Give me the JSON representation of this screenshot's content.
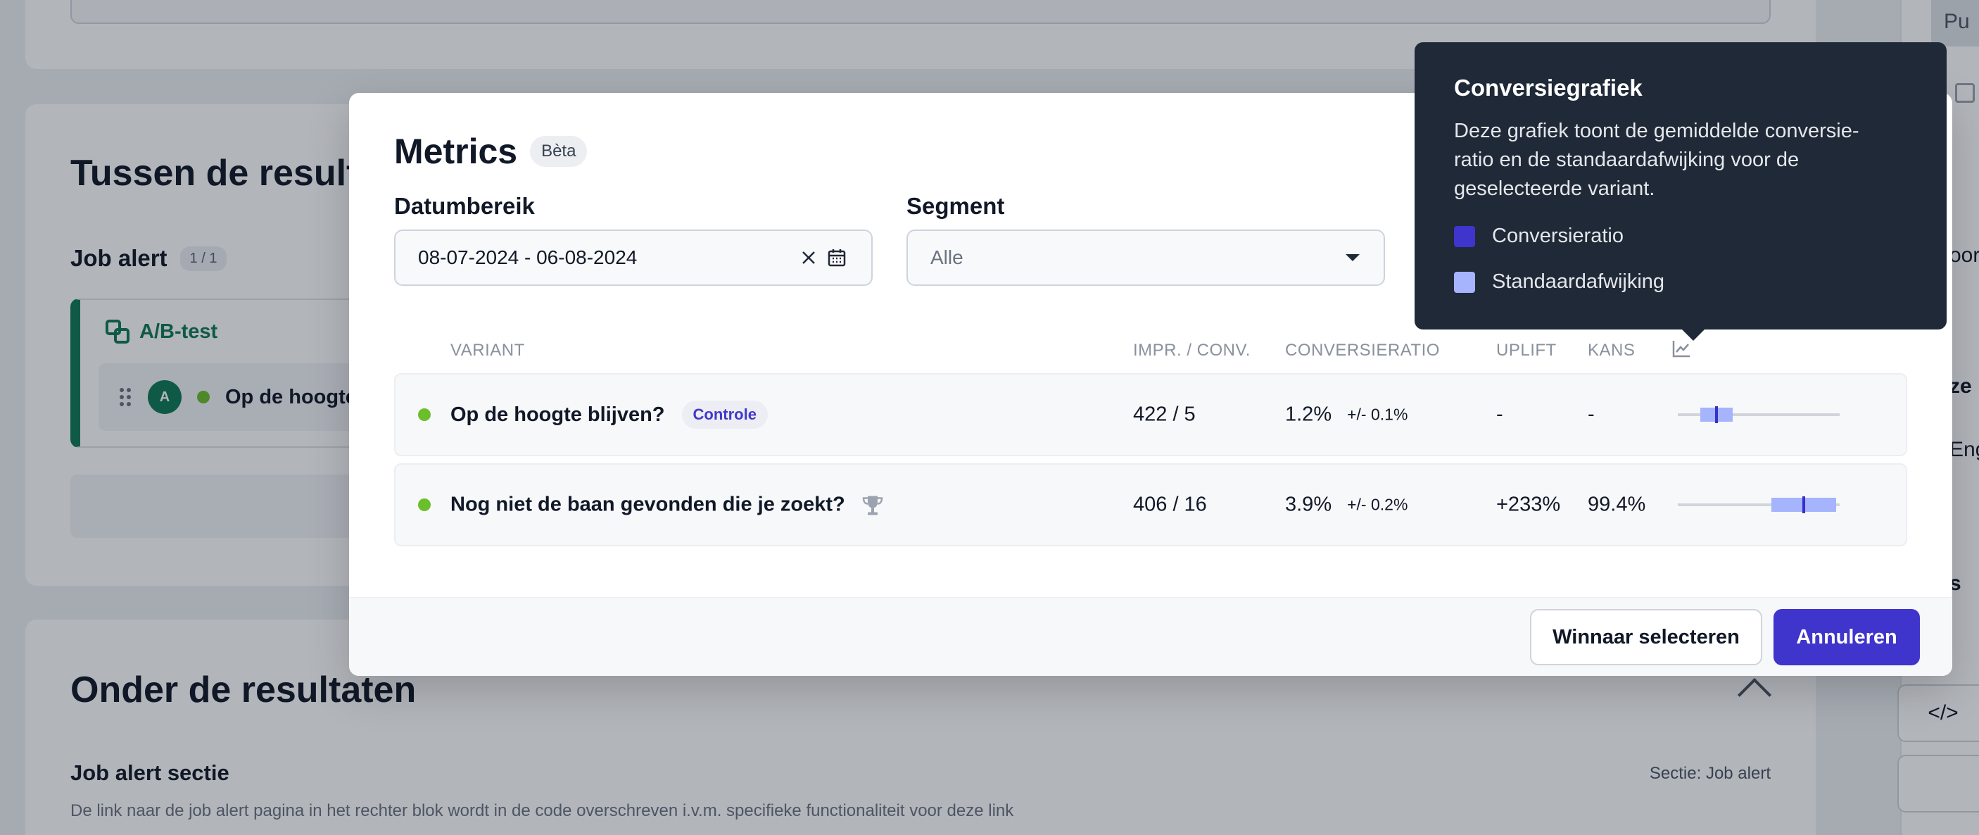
{
  "background": {
    "section1_title": "Tussen de resultaten",
    "job_alert_label": "Job alert",
    "job_alert_count": "1 / 1",
    "ab_title": "A/B-test",
    "ab_row_avatar": "A",
    "ab_row_text": "Op de hoogte blijven?",
    "section2_title": "Onder de resultaten",
    "sub_title": "Job alert sectie",
    "sub_right": "Sectie: Job alert",
    "sub_desc": "De link naar de job alert pagina in het rechter blok wordt in de code overschreven i.v.m. specifieke functionaliteit voor deze link",
    "publish_label": "Pu",
    "side_text_1": "oor",
    "side_text_2": "ze",
    "side_text_3": "Eng",
    "side_text_4": "s",
    "code_btn_label": "</>"
  },
  "modal": {
    "title": "Metrics",
    "beta_badge": "Bèta",
    "date_label": "Datumbereik",
    "date_value": "08-07-2024 - 06-08-2024",
    "segment_label": "Segment",
    "segment_value": "Alle",
    "columns": {
      "variant": "VARIANT",
      "impr_conv": "IMPR. / CONV.",
      "conversion": "CONVERSIERATIO",
      "uplift": "UPLIFT",
      "chance": "KANS"
    },
    "rows": [
      {
        "name": "Op de hoogte blijven?",
        "badge": "Controle",
        "impr_conv": "422 / 5",
        "rate": "1.2%",
        "pm": "+/- 0.1%",
        "uplift": "-",
        "chance": "-",
        "rate_value": 1.2,
        "sd_value": 0.1
      },
      {
        "name": "Nog niet de baan gevonden die je zoekt?",
        "impr_conv": "406 / 16",
        "rate": "3.9%",
        "pm": "+/- 0.2%",
        "uplift": "+233%",
        "chance": "99.4%",
        "rate_value": 3.9,
        "sd_value": 0.2,
        "winner": true
      }
    ],
    "chart_scale_max": 5.0,
    "btn_select_winner": "Winnaar selecteren",
    "btn_cancel": "Annuleren"
  },
  "tooltip": {
    "title": "Conversiegrafiek",
    "description": "Deze grafiek toont de gemiddelde conversie-ratio en de standaardafwijking voor de geselecteerde variant.",
    "legend": [
      {
        "label": "Conversieratio",
        "color": "#3f34cc"
      },
      {
        "label": "Standaardafwijking",
        "color": "#a5b4fc"
      }
    ]
  },
  "colors": {
    "primary": "#3f34cc",
    "brand_green": "#0f7a55",
    "status_green": "#6bbf2a",
    "tooltip_bg": "#1f2937"
  }
}
